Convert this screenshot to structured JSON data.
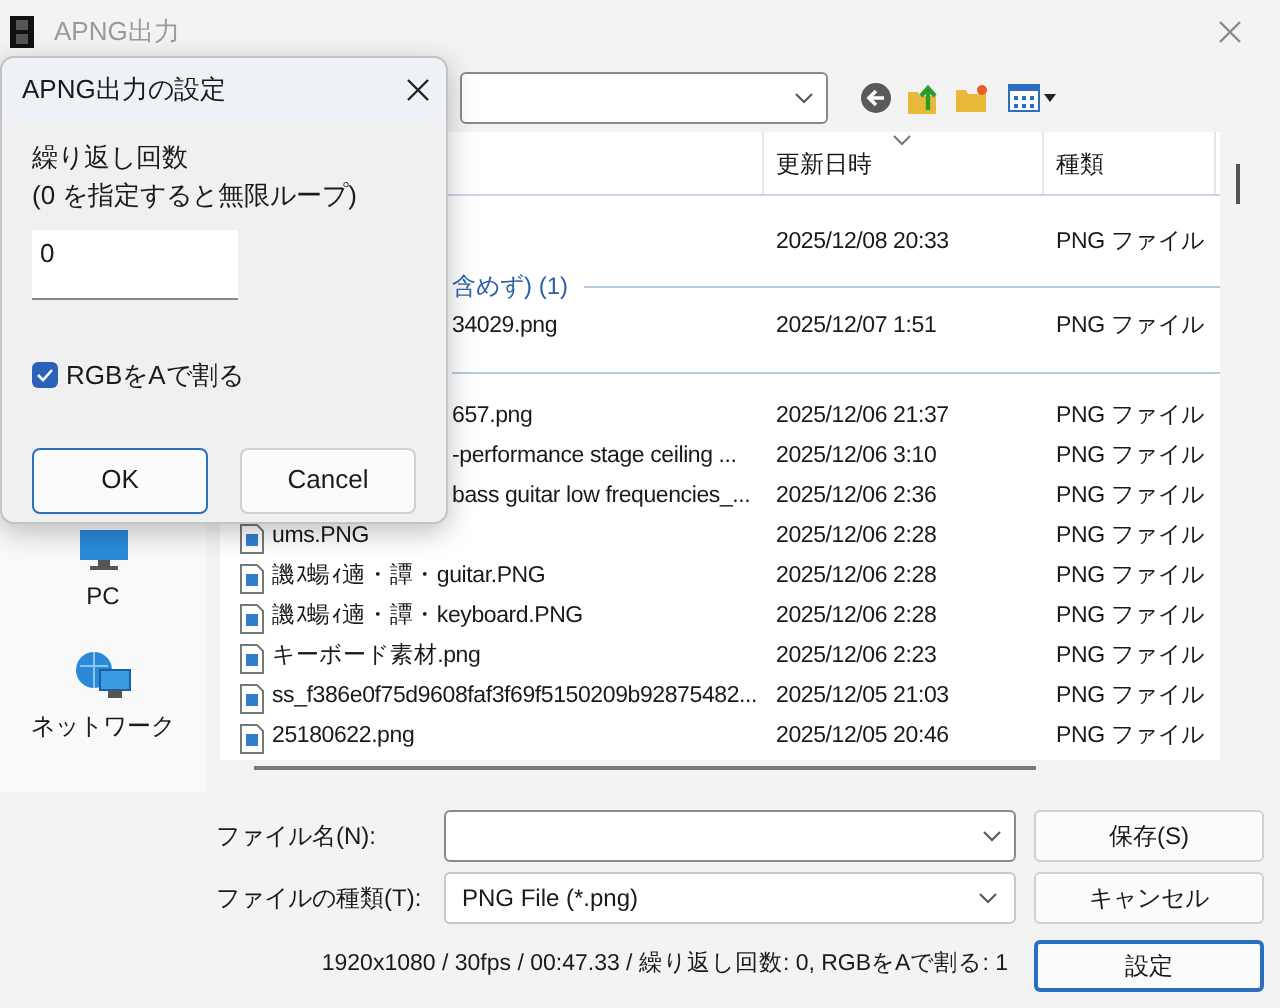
{
  "window": {
    "title": "APNG出力"
  },
  "sidebar": {
    "items": [
      {
        "label": "PC",
        "kind": "pc"
      },
      {
        "label": "ネットワーク",
        "kind": "network"
      }
    ]
  },
  "file_list": {
    "columns": [
      {
        "label": "更新日時",
        "sorted": true
      },
      {
        "label": "種類",
        "sorted": false
      }
    ],
    "rows": [
      {
        "kind": "file",
        "icon": false,
        "date": "2025/12/08 20:33",
        "type": "PNG ファイル"
      },
      {
        "kind": "group",
        "label": "含めず) (1)"
      },
      {
        "kind": "file",
        "icon": false,
        "name": "34029.png",
        "date": "2025/12/07 1:51",
        "type": "PNG ファイル"
      },
      {
        "kind": "group"
      },
      {
        "kind": "file",
        "icon": false,
        "name": "657.png",
        "date": "2025/12/06 21:37",
        "type": "PNG ファイル"
      },
      {
        "kind": "file",
        "icon": false,
        "name": "-performance stage ceiling ...",
        "date": "2025/12/06 3:10",
        "type": "PNG ファイル"
      },
      {
        "kind": "file",
        "icon": false,
        "name": "bass guitar low frequencies_...",
        "date": "2025/12/06 2:36",
        "type": "PNG ファイル"
      },
      {
        "kind": "file",
        "icon": true,
        "name": "ums.PNG",
        "date": "2025/12/06 2:28",
        "type": "PNG ファイル"
      },
      {
        "kind": "file",
        "icon": true,
        "name": "譏ｽ蝪ｨ遖・譚・guitar.PNG",
        "date": "2025/12/06 2:28",
        "type": "PNG ファイル"
      },
      {
        "kind": "file",
        "icon": true,
        "name": "譏ｽ蝪ｨ遖・譚・keyboard.PNG",
        "date": "2025/12/06 2:28",
        "type": "PNG ファイル"
      },
      {
        "kind": "file",
        "icon": true,
        "name": "キーボード素材.png",
        "date": "2025/12/06 2:23",
        "type": "PNG ファイル"
      },
      {
        "kind": "file",
        "icon": true,
        "name": "ss_f386e0f75d9608faf3f69f5150209b92875482...",
        "date": "2025/12/05 21:03",
        "type": "PNG ファイル"
      },
      {
        "kind": "file",
        "icon": true,
        "name": "25180622.png",
        "date": "2025/12/05 20:46",
        "type": "PNG ファイル"
      }
    ]
  },
  "file_name": {
    "label": "ファイル名(N):"
  },
  "file_type": {
    "label": "ファイルの種類(T):",
    "value": "PNG File (*.png)"
  },
  "buttons": [
    {
      "label": "保存(S)",
      "default": false
    },
    {
      "label": "キャンセル",
      "default": false
    },
    {
      "label": "設定",
      "default": true
    }
  ],
  "status": "1920x1080 / 30fps / 00:47.33 / 繰り返し回数: 0, RGBをAで割る: 1",
  "dialog": {
    "title": "APNG出力の設定",
    "label_lines": [
      "繰り返し回数",
      "(0 を指定すると無限ループ)"
    ],
    "loop_count": "0",
    "checkbox": {
      "label": "RGBをAで割る",
      "checked": true
    },
    "buttons": [
      {
        "label": "OK",
        "default": true
      },
      {
        "label": "Cancel",
        "default": false
      }
    ]
  }
}
